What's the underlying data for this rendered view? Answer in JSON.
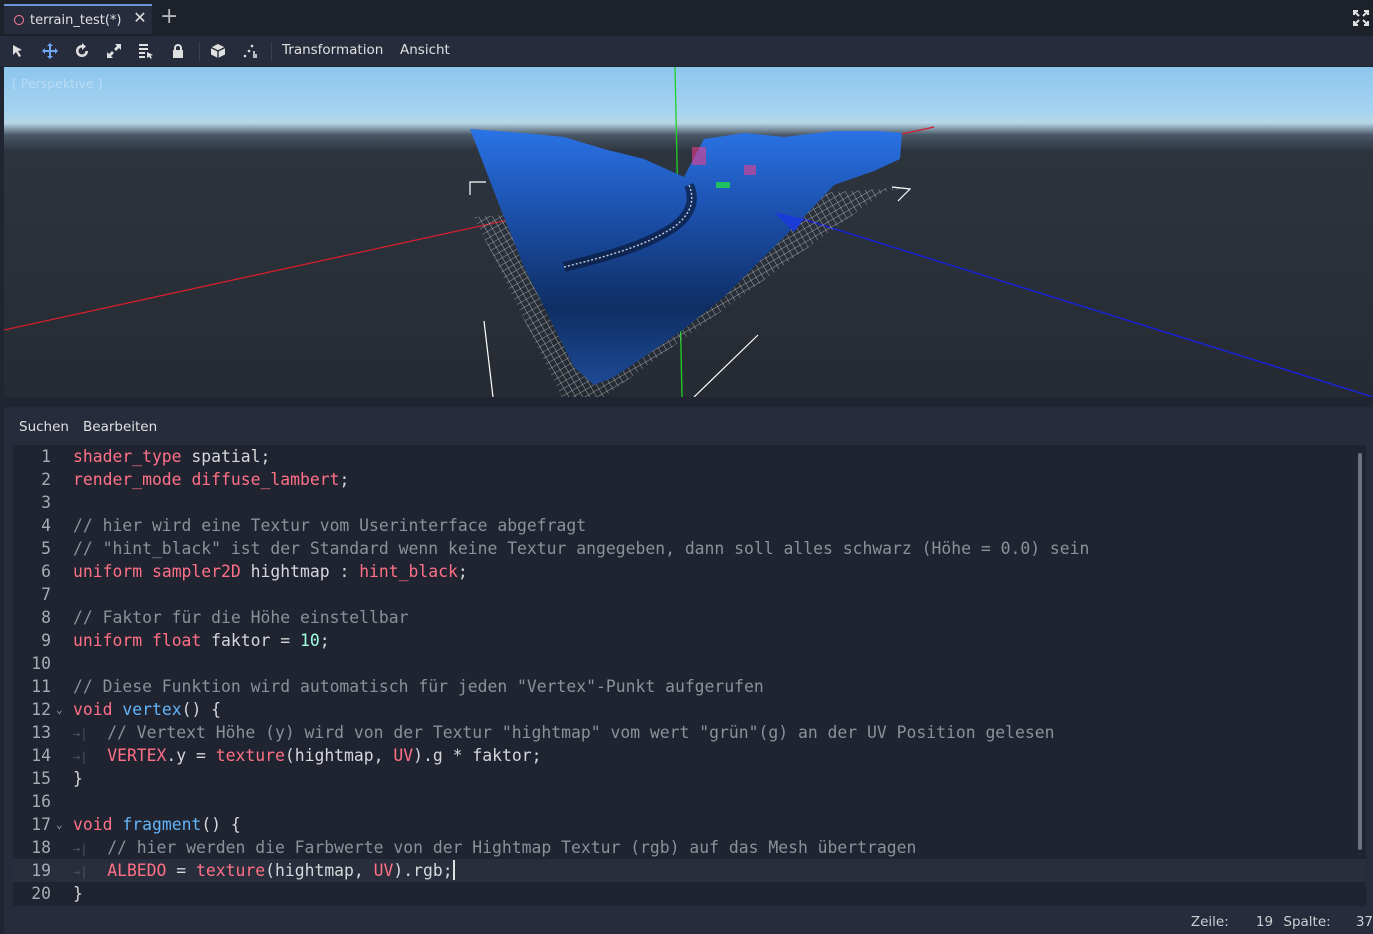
{
  "tab": {
    "title": "terrain_test(*)",
    "close_glyph": "✕",
    "new_tab_glyph": "+"
  },
  "toolbar": {
    "icons": [
      "select-icon",
      "move-icon",
      "rotate-icon",
      "scale-icon",
      "list-select-icon",
      "lock-icon",
      "group-icon",
      "snap-icon"
    ],
    "menus": [
      "Transformation",
      "Ansicht"
    ]
  },
  "viewport": {
    "label": "[ Perspektive ]",
    "colors": {
      "x_axis": "#d21f2e",
      "y_axis": "#20d025",
      "z_axis": "#1a22d6",
      "terrain": "#1e5fc8"
    }
  },
  "editor": {
    "menus": [
      "Suchen",
      "Bearbeiten"
    ],
    "lines": [
      [
        [
          "kw",
          "shader_type"
        ],
        [
          "t",
          " spatial;"
        ]
      ],
      [
        [
          "kw",
          "render_mode"
        ],
        [
          "t",
          " "
        ],
        [
          "kw",
          "diffuse_lambert"
        ],
        [
          "t",
          ";"
        ]
      ],
      [],
      [
        [
          "cm",
          "// hier wird eine Textur vom Userinterface abgefragt"
        ]
      ],
      [
        [
          "cm",
          "// \"hint_black\" ist der Standard wenn keine Textur angegeben, dann soll alles schwarz (Höhe = 0.0) sein"
        ]
      ],
      [
        [
          "kw",
          "uniform"
        ],
        [
          "t",
          " "
        ],
        [
          "kw",
          "sampler2D"
        ],
        [
          "t",
          " hightmap : "
        ],
        [
          "kw",
          "hint_black"
        ],
        [
          "t",
          ";"
        ]
      ],
      [],
      [
        [
          "cm",
          "// Faktor für die Höhe einstellbar"
        ]
      ],
      [
        [
          "kw",
          "uniform"
        ],
        [
          "t",
          " "
        ],
        [
          "kw",
          "float"
        ],
        [
          "t",
          " faktor = "
        ],
        [
          "num",
          "10"
        ],
        [
          "t",
          ";"
        ]
      ],
      [],
      [
        [
          "cm",
          "// Diese Funktion wird automatisch für jeden \"Vertex\"-Punkt aufgerufen"
        ]
      ],
      [
        [
          "kw",
          "void"
        ],
        [
          "t",
          " "
        ],
        [
          "fn",
          "vertex"
        ],
        [
          "t",
          "() {"
        ]
      ],
      [
        [
          "tab",
          "→|"
        ],
        [
          "cm",
          "  // Vertext Höhe (y) wird von der Textur \"hightmap\" vom wert \"grün\"(g) an der UV Position gelesen"
        ]
      ],
      [
        [
          "tab",
          "→|"
        ],
        [
          "t",
          "  "
        ],
        [
          "kw",
          "VERTEX"
        ],
        [
          "t",
          ".y = "
        ],
        [
          "kw",
          "texture"
        ],
        [
          "t",
          "(hightmap, "
        ],
        [
          "kw",
          "UV"
        ],
        [
          "t",
          ").g * faktor;"
        ]
      ],
      [
        [
          "t",
          "}"
        ]
      ],
      [],
      [
        [
          "kw",
          "void"
        ],
        [
          "t",
          " "
        ],
        [
          "fn",
          "fragment"
        ],
        [
          "t",
          "() {"
        ]
      ],
      [
        [
          "tab",
          "→|"
        ],
        [
          "cm",
          "  // hier werden die Farbwerte von der Hightmap Textur (rgb) auf das Mesh übertragen"
        ]
      ],
      [
        [
          "tab",
          "→|"
        ],
        [
          "t",
          "  "
        ],
        [
          "kw",
          "ALBEDO"
        ],
        [
          "t",
          " = "
        ],
        [
          "kw",
          "texture"
        ],
        [
          "t",
          "(hightmap, "
        ],
        [
          "kw",
          "UV"
        ],
        [
          "t",
          ").rgb;"
        ],
        [
          "caret",
          ""
        ]
      ],
      [
        [
          "t",
          "}"
        ]
      ]
    ],
    "folds": {
      "12": "⌄",
      "17": "⌄"
    },
    "current_line": 19
  },
  "status": {
    "line_label": "Zeile:",
    "line_value": "19",
    "col_label": "Spalte:",
    "col_value": "37"
  }
}
